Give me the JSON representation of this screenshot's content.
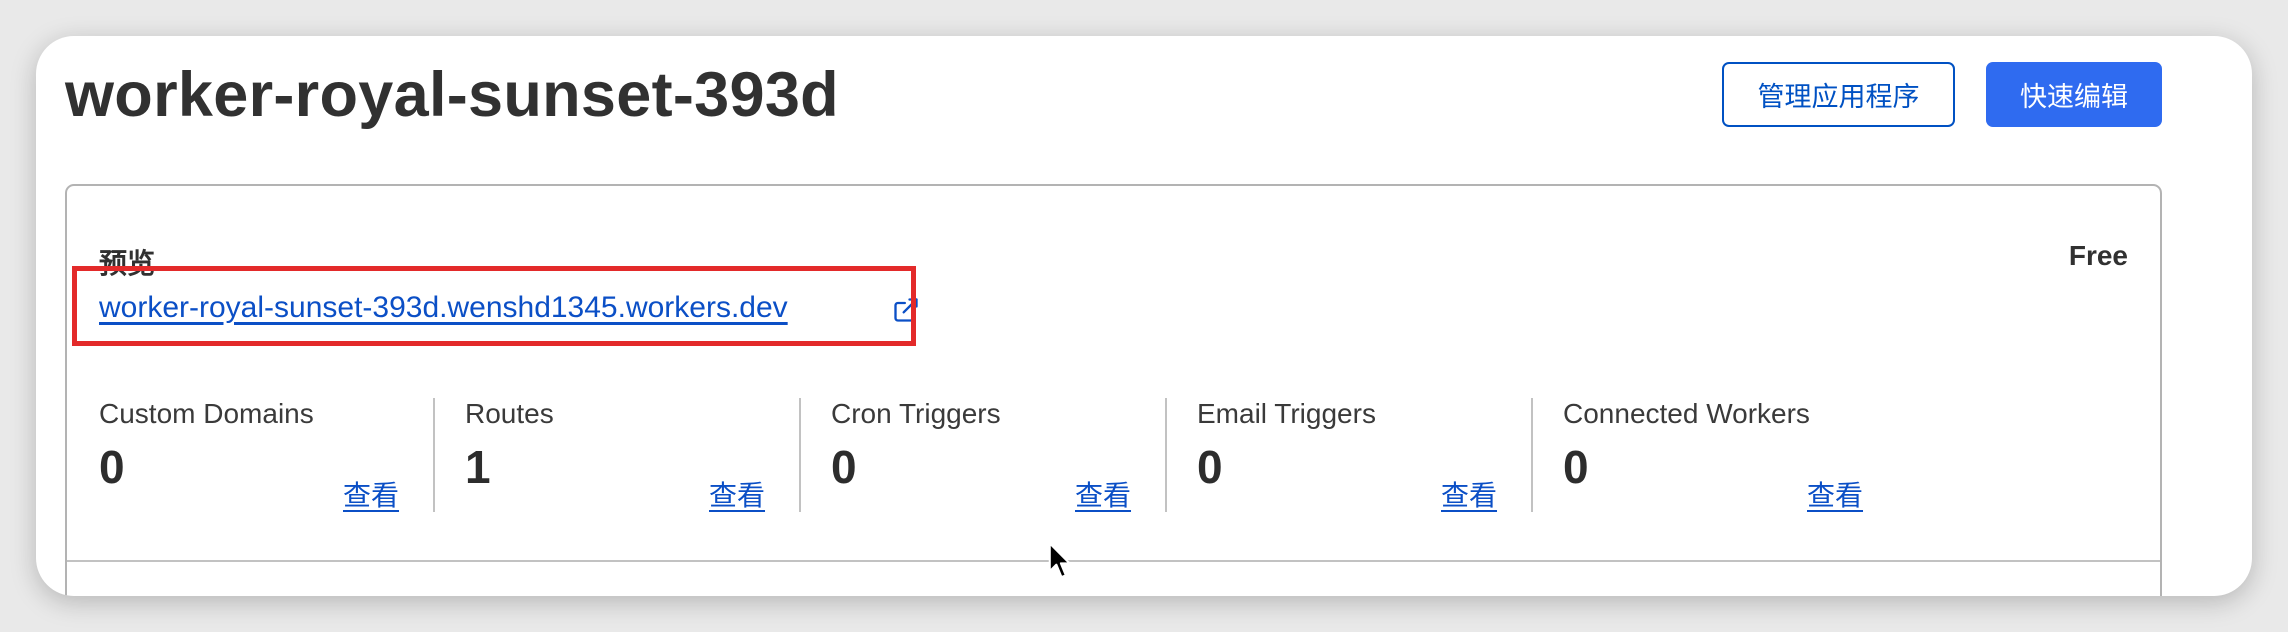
{
  "header": {
    "title": "worker-royal-sunset-393d",
    "manage_button": "管理应用程序",
    "quick_edit_button": "快速编辑"
  },
  "preview": {
    "label": "预览",
    "url": "worker-royal-sunset-393d.wenshd1345.workers.dev",
    "plan": "Free",
    "link_icon": "external-link-icon"
  },
  "stats": [
    {
      "label": "Custom Domains",
      "value": "0",
      "link": "查看"
    },
    {
      "label": "Routes",
      "value": "1",
      "link": "查看"
    },
    {
      "label": "Cron Triggers",
      "value": "0",
      "link": "查看"
    },
    {
      "label": "Email Triggers",
      "value": "0",
      "link": "查看"
    },
    {
      "label": "Connected Workers",
      "value": "0",
      "link": "查看"
    }
  ],
  "colors": {
    "primary": "#2f6bf0",
    "link": "#0b4fc6",
    "highlight": "#e32a2a"
  }
}
